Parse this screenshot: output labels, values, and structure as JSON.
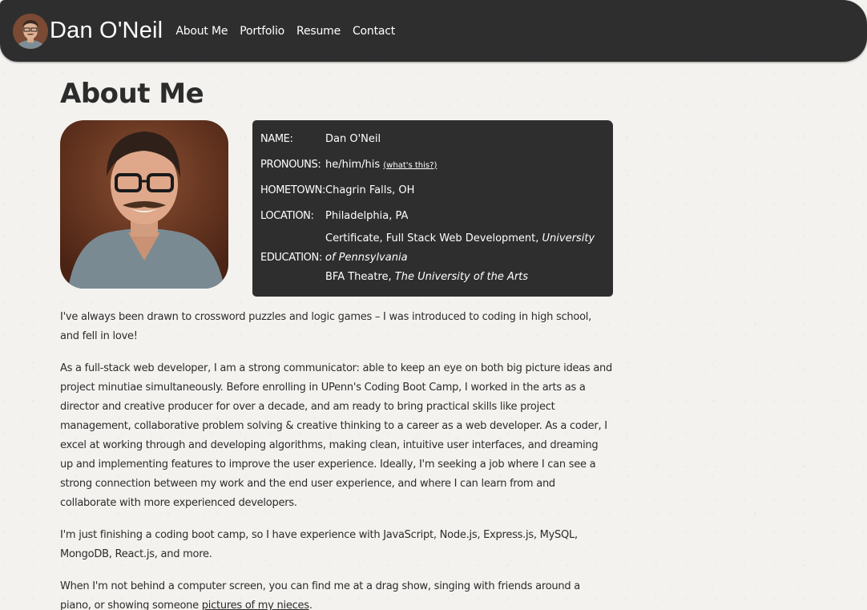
{
  "navbar": {
    "brand_name": "Dan O'Neil",
    "links": [
      {
        "label": "About Me"
      },
      {
        "label": "Portfolio"
      },
      {
        "label": "Resume"
      },
      {
        "label": "Contact"
      }
    ]
  },
  "page": {
    "title": "About Me"
  },
  "info": {
    "name_key": "NAME:",
    "name_value": "Dan O'Neil",
    "pronouns_key": "PRONOUNS:",
    "pronouns_value": "he/him/his",
    "pronouns_link": "(what's this?)",
    "hometown_key": "HOMETOWN:",
    "hometown_value": "Chagrin Falls, OH",
    "location_key": "LOCATION:",
    "location_value": "Philadelphia, PA",
    "education_key": "EDUCATION:",
    "education": [
      {
        "degree": "Certificate, Full Stack Web Development, ",
        "school": "University of Pennsylvania"
      },
      {
        "degree": "BFA Theatre, ",
        "school": "The University of the Arts"
      }
    ]
  },
  "bio": {
    "p1": "I've always been drawn to crossword puzzles and logic games – I was introduced to coding in high school, and fell in love!",
    "p2": "As a full-stack web developer, I am a strong communicator: able to keep an eye on both big picture ideas and project minutiae simultaneously. Before enrolling in UPenn's Coding Boot Camp, I worked in the arts as a director and creative producer for over a decade, and am ready to bring practical skills like project management, collaborative problem solving & creative thinking to a career as a web developer. As a coder, I excel at working through and developing algorithms, making clean, intuitive user interfaces, and dreaming up and implementing features to improve the user experience. Ideally, I'm seeking a job where I can see a strong connection between my work and the end user experience, and where I can learn from and collaborate with more experienced developers.",
    "p3": "I'm just finishing a coding boot camp, so I have experience with JavaScript, Node.js, Express.js, MySQL, MongoDB, React.js, and more.",
    "p4_text": "When I'm not behind a computer screen, you can find me at a drag show, singing with friends around a piano, or showing someone ",
    "p4_link": "pictures of my nieces",
    "p4_end": "."
  },
  "colors": {
    "navbar_bg": "#2e2e2e",
    "page_bg": "#f3f2ef",
    "text": "#2c2c2c",
    "card_bg": "#2e2e2e"
  }
}
